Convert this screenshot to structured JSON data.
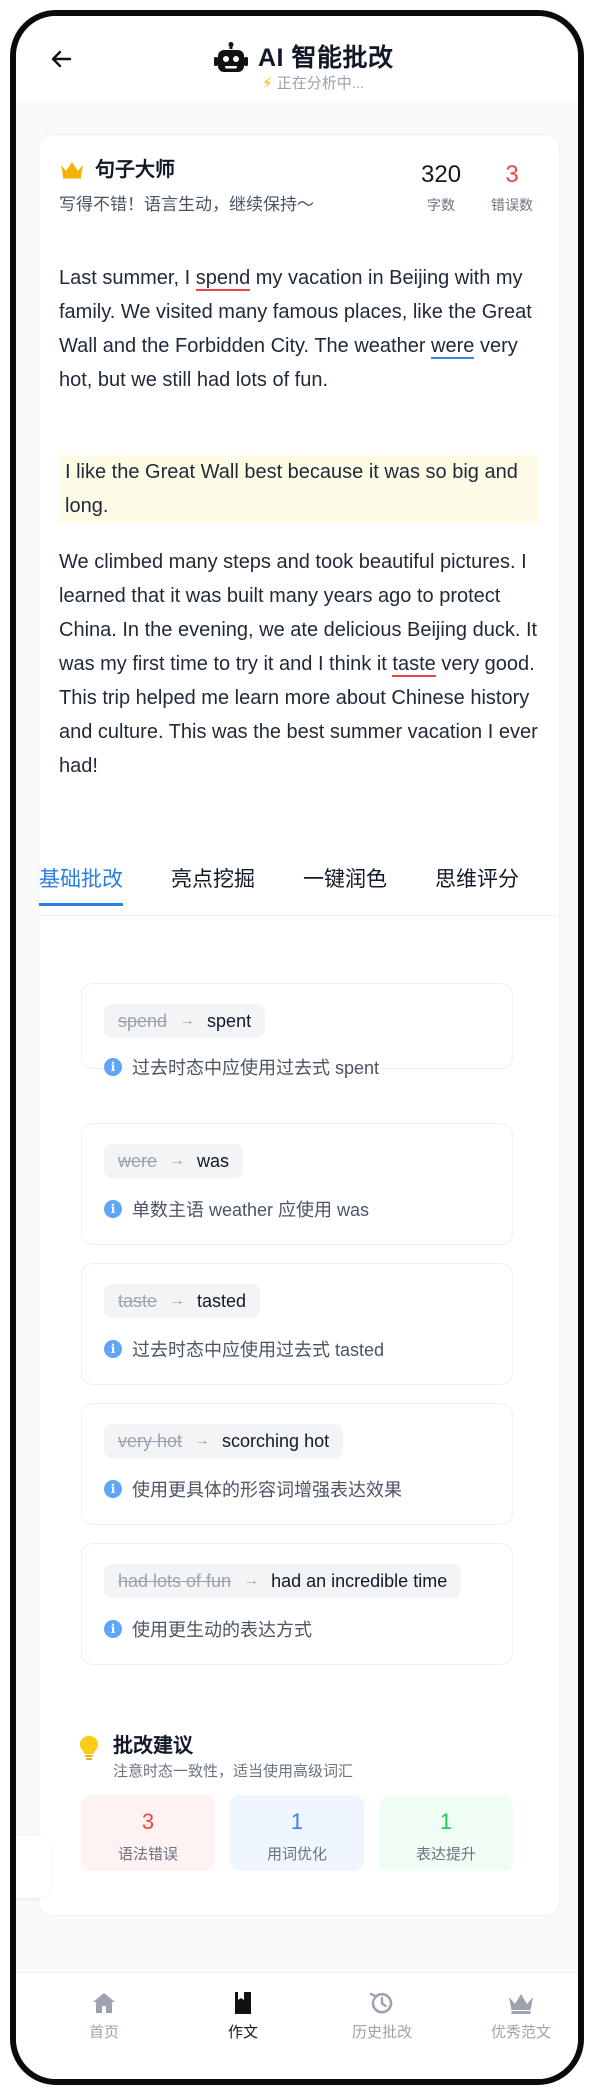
{
  "header": {
    "title": "AI 智能批改",
    "status": "正在分析中..."
  },
  "summary": {
    "badge": "句子大师",
    "praise": "写得不错！语言生动，继续保持～",
    "word_count": "320",
    "word_count_label": "字数",
    "error_count": "3",
    "error_count_label": "错误数"
  },
  "essay": {
    "p1": {
      "a": "Last summer, I ",
      "u1": "spend",
      "b": " my vacation in Beijing with my family. We visited many famous places, like the Great Wall and the Forbidden City. The weather ",
      "u2": "were",
      "c": " very hot, but we still had lots of fun."
    },
    "p2": "I like the Great Wall best because it was so big and long.",
    "p3": {
      "a": "We climbed many steps and took beautiful pictures. I learned that it was built many years ago to protect China. In the evening, we ate delicious Beijing duck. It was my first time to try it and I think it ",
      "u": "taste",
      "b": " very good. This trip helped me learn more about Chinese history and culture. This was the best summer vacation I ever had!"
    }
  },
  "tabs": [
    "基础批改",
    "亮点挖掘",
    "一键润色",
    "思维评分"
  ],
  "corrections": [
    {
      "old": "spend",
      "new": "spent",
      "reason": "过去时态中应使用过去式 spent"
    },
    {
      "old": "were",
      "new": "was",
      "reason": "单数主语 weather 应使用 was"
    },
    {
      "old": "taste",
      "new": "tasted",
      "reason": "过去时态中应使用过去式 tasted"
    },
    {
      "old": "very hot",
      "new": "scorching hot",
      "reason": "使用更具体的形容词增强表达效果"
    },
    {
      "old": "had lots of fun",
      "new": "had an incredible time",
      "reason": "使用更生动的表达方式"
    }
  ],
  "suggestions": {
    "title": "批改建议",
    "subtitle": "注意时态一致性，适当使用高级词汇",
    "boxes": [
      {
        "num": "3",
        "label": "语法错误",
        "color": "#ef4444",
        "bg": "#fef2f2"
      },
      {
        "num": "1",
        "label": "用词优化",
        "color": "#3b82f6",
        "bg": "#eff6ff"
      },
      {
        "num": "1",
        "label": "表达提升",
        "color": "#22c55e",
        "bg": "#f0fdf4"
      }
    ]
  },
  "nav": [
    "首页",
    "作文",
    "历史批改",
    "优秀范文"
  ],
  "icons": {
    "back": "arrow-left-icon",
    "robot": "robot-icon",
    "crown": "crown-icon",
    "info": "info-icon",
    "bulb": "lightbulb-icon"
  }
}
